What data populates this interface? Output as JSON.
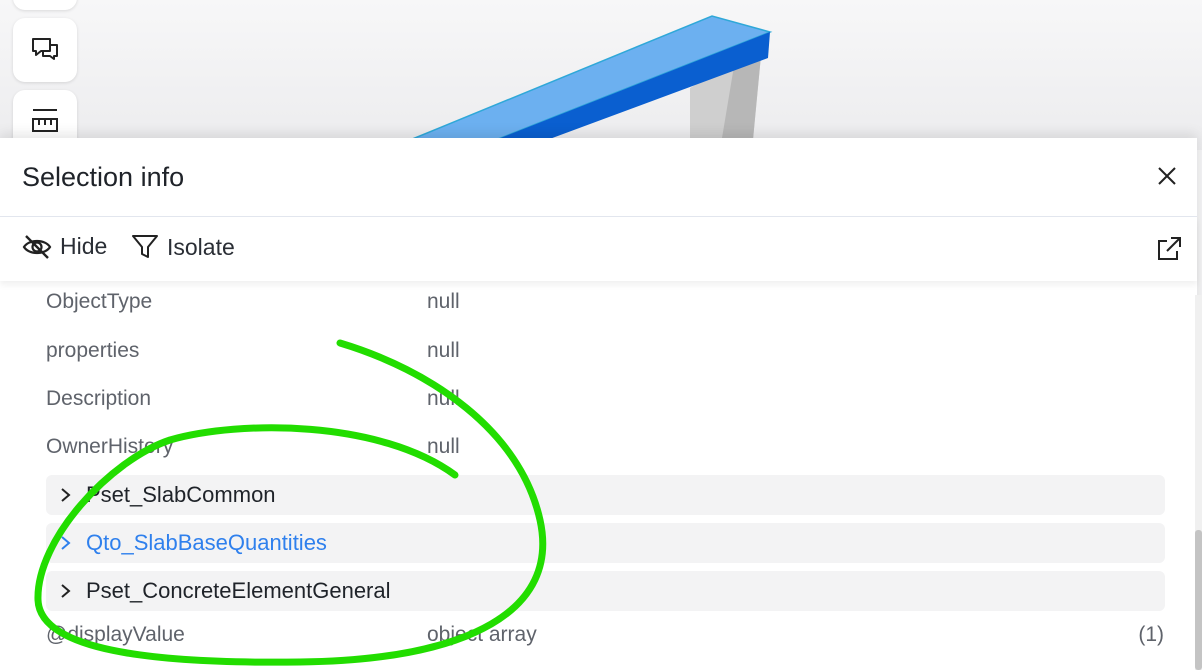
{
  "panel": {
    "title": "Selection info",
    "actions": {
      "hide_label": "Hide",
      "isolate_label": "Isolate"
    }
  },
  "properties": [
    {
      "key": "ObjectType",
      "value": "null"
    },
    {
      "key": "properties",
      "value": "null"
    },
    {
      "key": "Description",
      "value": "null"
    },
    {
      "key": "OwnerHistory",
      "value": "null"
    }
  ],
  "groups": [
    {
      "label": "Pset_SlabCommon"
    },
    {
      "label": "Qto_SlabBaseQuantities"
    },
    {
      "label": "Pset_ConcreteElementGeneral"
    }
  ],
  "display_value": {
    "key": "@displayValue",
    "value": "object array",
    "count": "(1)"
  },
  "colors": {
    "accent": "#2f80ed",
    "annotation": "#22dd00",
    "model_top": "#6cb0f0",
    "model_side": "#0a5fd0"
  }
}
